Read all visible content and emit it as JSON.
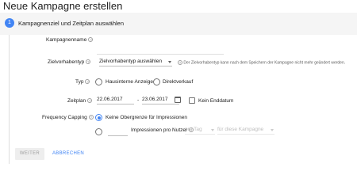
{
  "page": {
    "title": "Neue Kampagne erstellen"
  },
  "step": {
    "number": "1",
    "title": "Kampagnenziel und Zeitplan auswählen"
  },
  "form": {
    "campaign_name": {
      "label": "Kampagnenname",
      "value": ""
    },
    "goal_type": {
      "label": "Zielvorhabentyp",
      "selected": "Zielvorhabentyp auswählen",
      "hint": "Der Zielvorhabentyp kann nach dem Speichern der Kampagne nicht mehr geändert werden."
    },
    "type": {
      "label": "Typ",
      "options": [
        "Hausinterne Anzeige",
        "Direktverkauf"
      ],
      "selected_index": -1
    },
    "schedule": {
      "label": "Zeitplan",
      "start_date": "22.06.2017",
      "separator": "-",
      "end_date": "23.06.2017",
      "no_end_date_label": "Kein Enddatum",
      "no_end_date_checked": false
    },
    "frequency_capping": {
      "label": "Frequency Capping",
      "option_no_limit": "Keine Obergrenze für Impressionen",
      "option_per_user": "Impressionen pro Nutzer",
      "per_user_value": "",
      "period_select": "pro Tag",
      "scope_select": "für diese Kampagne",
      "selected": "no_limit"
    }
  },
  "actions": {
    "next_label": "WEITER",
    "cancel_label": "ABBRECHEN"
  },
  "colors": {
    "accent": "#4285f4",
    "disabled_text": "#bdbdbd",
    "header_bg": "#f5f5f5"
  },
  "icons": {
    "help": "help-circle-icon",
    "calendar": "calendar-icon",
    "dropdown": "caret-down-icon"
  }
}
